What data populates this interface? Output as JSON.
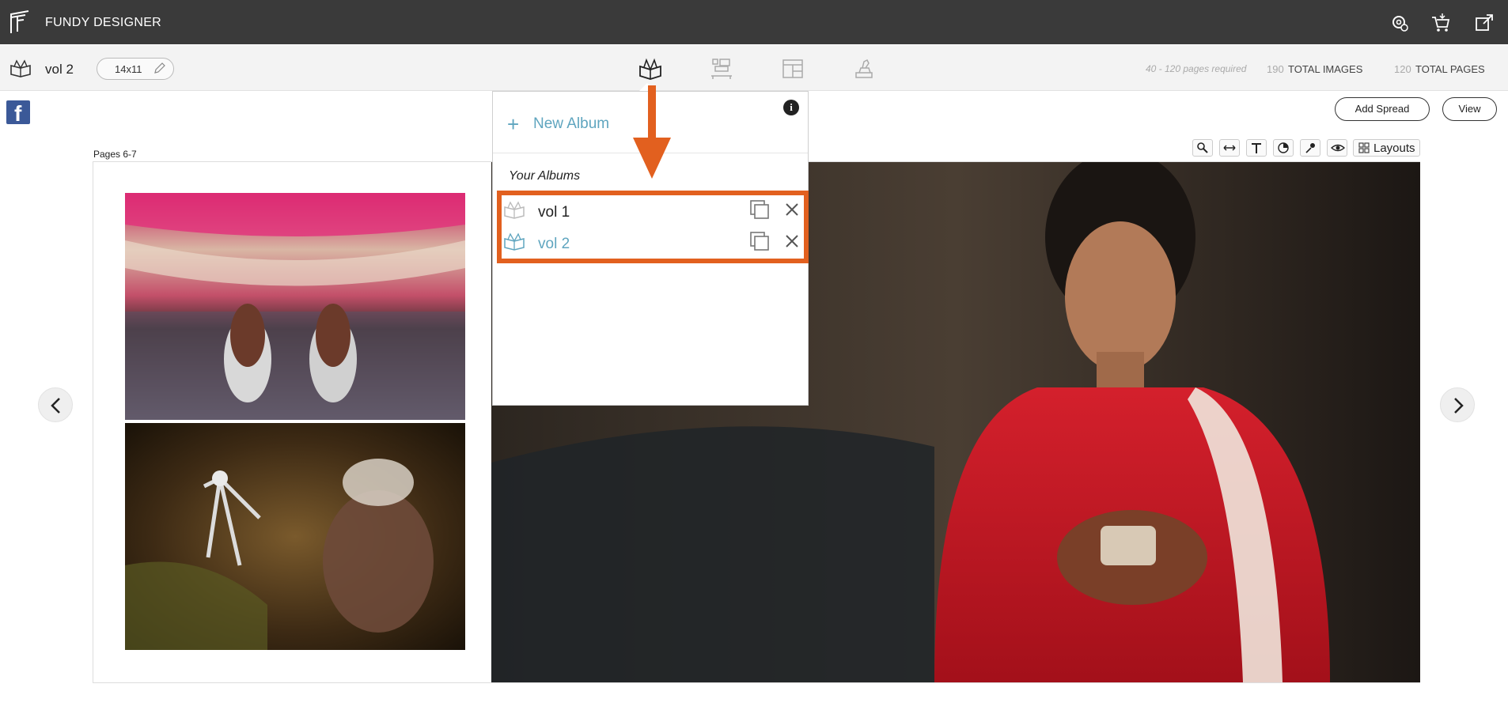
{
  "app": {
    "name": "FUNDY DESIGNER"
  },
  "toolbar": {
    "album_title": "vol 2",
    "album_size": "14x11",
    "pages_required": "40 - 120 pages required",
    "total_images_count": "190",
    "total_images_label": "TOTAL IMAGES",
    "total_pages_count": "120",
    "total_pages_label": "TOTAL PAGES"
  },
  "actions": {
    "add_spread": "Add Spread",
    "view": "View",
    "layouts": "Layouts"
  },
  "spread": {
    "label": "Pages 6-7"
  },
  "popover": {
    "new_album_label": "New Album",
    "section_title": "Your Albums",
    "albums": [
      {
        "name": "vol 1",
        "active": false
      },
      {
        "name": "vol 2",
        "active": true
      }
    ]
  },
  "colors": {
    "accent": "#5fa5bf",
    "highlight": "#e2601f",
    "topbar": "#3a3a3a"
  }
}
